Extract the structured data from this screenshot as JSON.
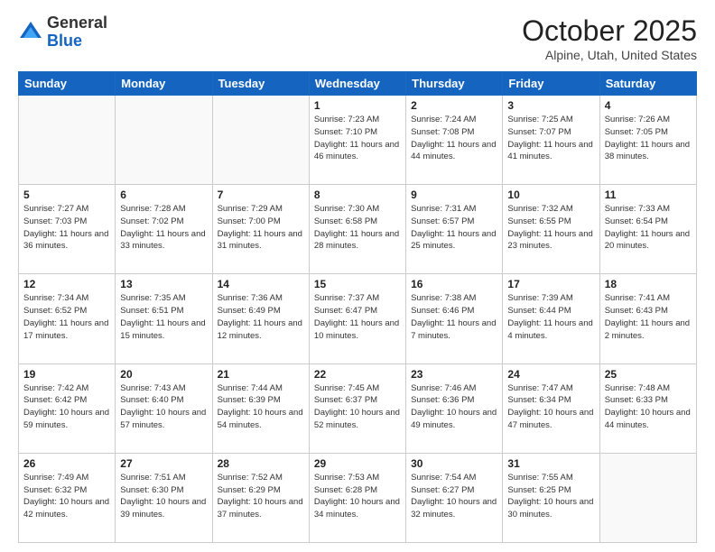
{
  "header": {
    "logo_general": "General",
    "logo_blue": "Blue",
    "month_title": "October 2025",
    "location": "Alpine, Utah, United States"
  },
  "weekdays": [
    "Sunday",
    "Monday",
    "Tuesday",
    "Wednesday",
    "Thursday",
    "Friday",
    "Saturday"
  ],
  "weeks": [
    [
      {
        "day": "",
        "info": ""
      },
      {
        "day": "",
        "info": ""
      },
      {
        "day": "",
        "info": ""
      },
      {
        "day": "1",
        "info": "Sunrise: 7:23 AM\nSunset: 7:10 PM\nDaylight: 11 hours\nand 46 minutes."
      },
      {
        "day": "2",
        "info": "Sunrise: 7:24 AM\nSunset: 7:08 PM\nDaylight: 11 hours\nand 44 minutes."
      },
      {
        "day": "3",
        "info": "Sunrise: 7:25 AM\nSunset: 7:07 PM\nDaylight: 11 hours\nand 41 minutes."
      },
      {
        "day": "4",
        "info": "Sunrise: 7:26 AM\nSunset: 7:05 PM\nDaylight: 11 hours\nand 38 minutes."
      }
    ],
    [
      {
        "day": "5",
        "info": "Sunrise: 7:27 AM\nSunset: 7:03 PM\nDaylight: 11 hours\nand 36 minutes."
      },
      {
        "day": "6",
        "info": "Sunrise: 7:28 AM\nSunset: 7:02 PM\nDaylight: 11 hours\nand 33 minutes."
      },
      {
        "day": "7",
        "info": "Sunrise: 7:29 AM\nSunset: 7:00 PM\nDaylight: 11 hours\nand 31 minutes."
      },
      {
        "day": "8",
        "info": "Sunrise: 7:30 AM\nSunset: 6:58 PM\nDaylight: 11 hours\nand 28 minutes."
      },
      {
        "day": "9",
        "info": "Sunrise: 7:31 AM\nSunset: 6:57 PM\nDaylight: 11 hours\nand 25 minutes."
      },
      {
        "day": "10",
        "info": "Sunrise: 7:32 AM\nSunset: 6:55 PM\nDaylight: 11 hours\nand 23 minutes."
      },
      {
        "day": "11",
        "info": "Sunrise: 7:33 AM\nSunset: 6:54 PM\nDaylight: 11 hours\nand 20 minutes."
      }
    ],
    [
      {
        "day": "12",
        "info": "Sunrise: 7:34 AM\nSunset: 6:52 PM\nDaylight: 11 hours\nand 17 minutes."
      },
      {
        "day": "13",
        "info": "Sunrise: 7:35 AM\nSunset: 6:51 PM\nDaylight: 11 hours\nand 15 minutes."
      },
      {
        "day": "14",
        "info": "Sunrise: 7:36 AM\nSunset: 6:49 PM\nDaylight: 11 hours\nand 12 minutes."
      },
      {
        "day": "15",
        "info": "Sunrise: 7:37 AM\nSunset: 6:47 PM\nDaylight: 11 hours\nand 10 minutes."
      },
      {
        "day": "16",
        "info": "Sunrise: 7:38 AM\nSunset: 6:46 PM\nDaylight: 11 hours\nand 7 minutes."
      },
      {
        "day": "17",
        "info": "Sunrise: 7:39 AM\nSunset: 6:44 PM\nDaylight: 11 hours\nand 4 minutes."
      },
      {
        "day": "18",
        "info": "Sunrise: 7:41 AM\nSunset: 6:43 PM\nDaylight: 11 hours\nand 2 minutes."
      }
    ],
    [
      {
        "day": "19",
        "info": "Sunrise: 7:42 AM\nSunset: 6:42 PM\nDaylight: 10 hours\nand 59 minutes."
      },
      {
        "day": "20",
        "info": "Sunrise: 7:43 AM\nSunset: 6:40 PM\nDaylight: 10 hours\nand 57 minutes."
      },
      {
        "day": "21",
        "info": "Sunrise: 7:44 AM\nSunset: 6:39 PM\nDaylight: 10 hours\nand 54 minutes."
      },
      {
        "day": "22",
        "info": "Sunrise: 7:45 AM\nSunset: 6:37 PM\nDaylight: 10 hours\nand 52 minutes."
      },
      {
        "day": "23",
        "info": "Sunrise: 7:46 AM\nSunset: 6:36 PM\nDaylight: 10 hours\nand 49 minutes."
      },
      {
        "day": "24",
        "info": "Sunrise: 7:47 AM\nSunset: 6:34 PM\nDaylight: 10 hours\nand 47 minutes."
      },
      {
        "day": "25",
        "info": "Sunrise: 7:48 AM\nSunset: 6:33 PM\nDaylight: 10 hours\nand 44 minutes."
      }
    ],
    [
      {
        "day": "26",
        "info": "Sunrise: 7:49 AM\nSunset: 6:32 PM\nDaylight: 10 hours\nand 42 minutes."
      },
      {
        "day": "27",
        "info": "Sunrise: 7:51 AM\nSunset: 6:30 PM\nDaylight: 10 hours\nand 39 minutes."
      },
      {
        "day": "28",
        "info": "Sunrise: 7:52 AM\nSunset: 6:29 PM\nDaylight: 10 hours\nand 37 minutes."
      },
      {
        "day": "29",
        "info": "Sunrise: 7:53 AM\nSunset: 6:28 PM\nDaylight: 10 hours\nand 34 minutes."
      },
      {
        "day": "30",
        "info": "Sunrise: 7:54 AM\nSunset: 6:27 PM\nDaylight: 10 hours\nand 32 minutes."
      },
      {
        "day": "31",
        "info": "Sunrise: 7:55 AM\nSunset: 6:25 PM\nDaylight: 10 hours\nand 30 minutes."
      },
      {
        "day": "",
        "info": ""
      }
    ]
  ]
}
